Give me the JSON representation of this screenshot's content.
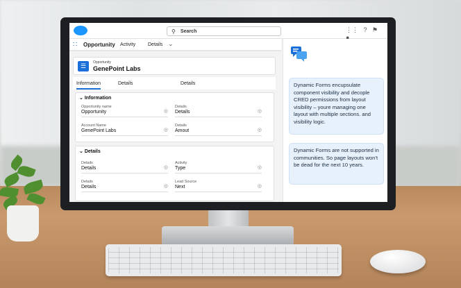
{
  "app": {
    "name": "Opportunity",
    "nav_items": [
      "Activity",
      "Details"
    ],
    "search_placeholder": "Search"
  },
  "record": {
    "subtitle": "Opportunity",
    "name": "GenePoint Labs"
  },
  "tabs": [
    "Information",
    "Details",
    "Details"
  ],
  "sections": [
    {
      "title": "Information",
      "fields": [
        {
          "label": "Opportunity name",
          "value": "Opportunity"
        },
        {
          "label": "Details",
          "value": "Details"
        },
        {
          "label": "Account Name",
          "value": "GenePoint Labs"
        },
        {
          "label": "Details",
          "value": "Amout"
        }
      ]
    },
    {
      "title": "Details",
      "fields": [
        {
          "label": "Details",
          "value": "Details"
        },
        {
          "label": "Activity",
          "value": "Type"
        },
        {
          "label": "Details",
          "value": "Details"
        },
        {
          "label": "Lead Source",
          "value": "Next"
        }
      ]
    }
  ],
  "chat": {
    "messages": [
      "Dynamic Forms encupsulate component visibility and decople CRED permissions from layout visibility – youre managing one layout with multiple sections. and visibility logic.",
      "Dynamic Forms are not supported in communities. So page layouts won’t be dead for the next 10 years."
    ]
  },
  "colors": {
    "accent": "#1b6fd8",
    "bubble": "#e7f1fb",
    "desk": "#b88a5e"
  },
  "icons": [
    "salesforce-logo-icon",
    "search-icon",
    "app-launcher-icon",
    "help-icon",
    "notification-bell-icon",
    "user-icon",
    "chevron-down-icon",
    "edit-pencil-icon",
    "chat-bubbles-icon"
  ]
}
